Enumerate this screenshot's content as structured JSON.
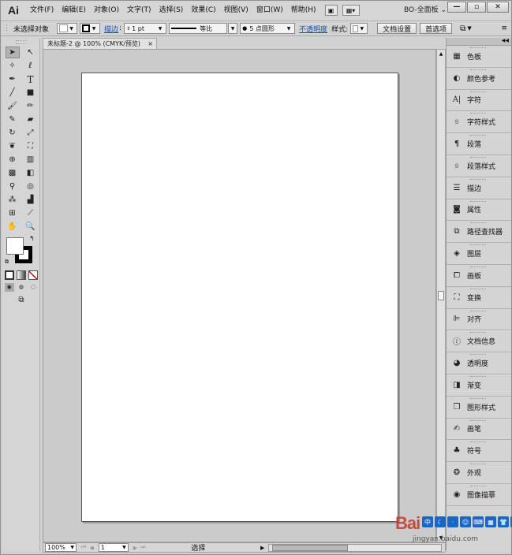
{
  "app": {
    "logo": "Ai",
    "workspace": "BO-全面板"
  },
  "menu": [
    "文件(F)",
    "编辑(E)",
    "对象(O)",
    "文字(T)",
    "选择(S)",
    "效果(C)",
    "视图(V)",
    "窗口(W)",
    "帮助(H)"
  ],
  "window_buttons": [
    "—",
    "▫",
    "✕"
  ],
  "control": {
    "selection": "未选择对象",
    "stroke_link": "描边",
    "stroke_weight": "1 pt",
    "stroke_profile": "等比",
    "brush": "5 点圆形",
    "opacity_link": "不透明度",
    "style_label": "样式:",
    "doc_setup": "文档设置",
    "preferences": "首选项"
  },
  "document": {
    "tab_title": "未标题-2 @ 100% (CMYK/预览)",
    "close": "×"
  },
  "status": {
    "zoom": "100%",
    "page": "1",
    "tool": "选择"
  },
  "tools": [
    [
      "arrow-icon",
      "direct-select-icon"
    ],
    [
      "magic-wand-icon",
      "lasso-icon"
    ],
    [
      "pen-icon",
      "type-icon"
    ],
    [
      "line-icon",
      "rectangle-icon"
    ],
    [
      "paintbrush-icon",
      "pencil-icon"
    ],
    [
      "blob-brush-icon",
      "eraser-icon"
    ],
    [
      "rotate-icon",
      "scale-icon"
    ],
    [
      "warp-icon",
      "free-transform-icon"
    ],
    [
      "shape-builder-icon",
      "perspective-icon"
    ],
    [
      "mesh-icon",
      "gradient-icon"
    ],
    [
      "eyedropper-icon",
      "blend-icon"
    ],
    [
      "symbol-sprayer-icon",
      "graph-icon"
    ],
    [
      "artboard-icon",
      "slice-icon"
    ],
    [
      "hand-icon",
      "zoom-icon"
    ]
  ],
  "panels": [
    {
      "icon": "color-icon",
      "label": "色板"
    },
    {
      "icon": "color-guide-icon",
      "label": "颜色参考"
    },
    {
      "icon": "character-icon",
      "label": "字符"
    },
    {
      "icon": "character-styles-icon",
      "label": "字符样式"
    },
    {
      "icon": "paragraph-icon",
      "label": "段落"
    },
    {
      "icon": "paragraph-styles-icon",
      "label": "段落样式"
    },
    {
      "icon": "stroke-icon",
      "label": "描边"
    },
    {
      "icon": "attributes-icon",
      "label": "属性"
    },
    {
      "icon": "pathfinder-icon",
      "label": "路径查找器"
    },
    {
      "icon": "layers-icon",
      "label": "图层"
    },
    {
      "icon": "artboards-icon",
      "label": "画板"
    },
    {
      "icon": "transform-icon",
      "label": "变换"
    },
    {
      "icon": "align-icon",
      "label": "对齐"
    },
    {
      "icon": "document-info-icon",
      "label": "文档信息"
    },
    {
      "icon": "transparency-icon",
      "label": "透明度"
    },
    {
      "icon": "gradient-panel-icon",
      "label": "渐变"
    },
    {
      "icon": "graphic-styles-icon",
      "label": "图形样式"
    },
    {
      "icon": "brushes-icon",
      "label": "画笔"
    },
    {
      "icon": "symbols-icon",
      "label": "符号"
    },
    {
      "icon": "appearance-icon",
      "label": "外观"
    },
    {
      "icon": "image-trace-icon",
      "label": "图像描摹"
    }
  ],
  "watermark": {
    "brand": "Bai",
    "site": "jingyan.baidu.com"
  }
}
